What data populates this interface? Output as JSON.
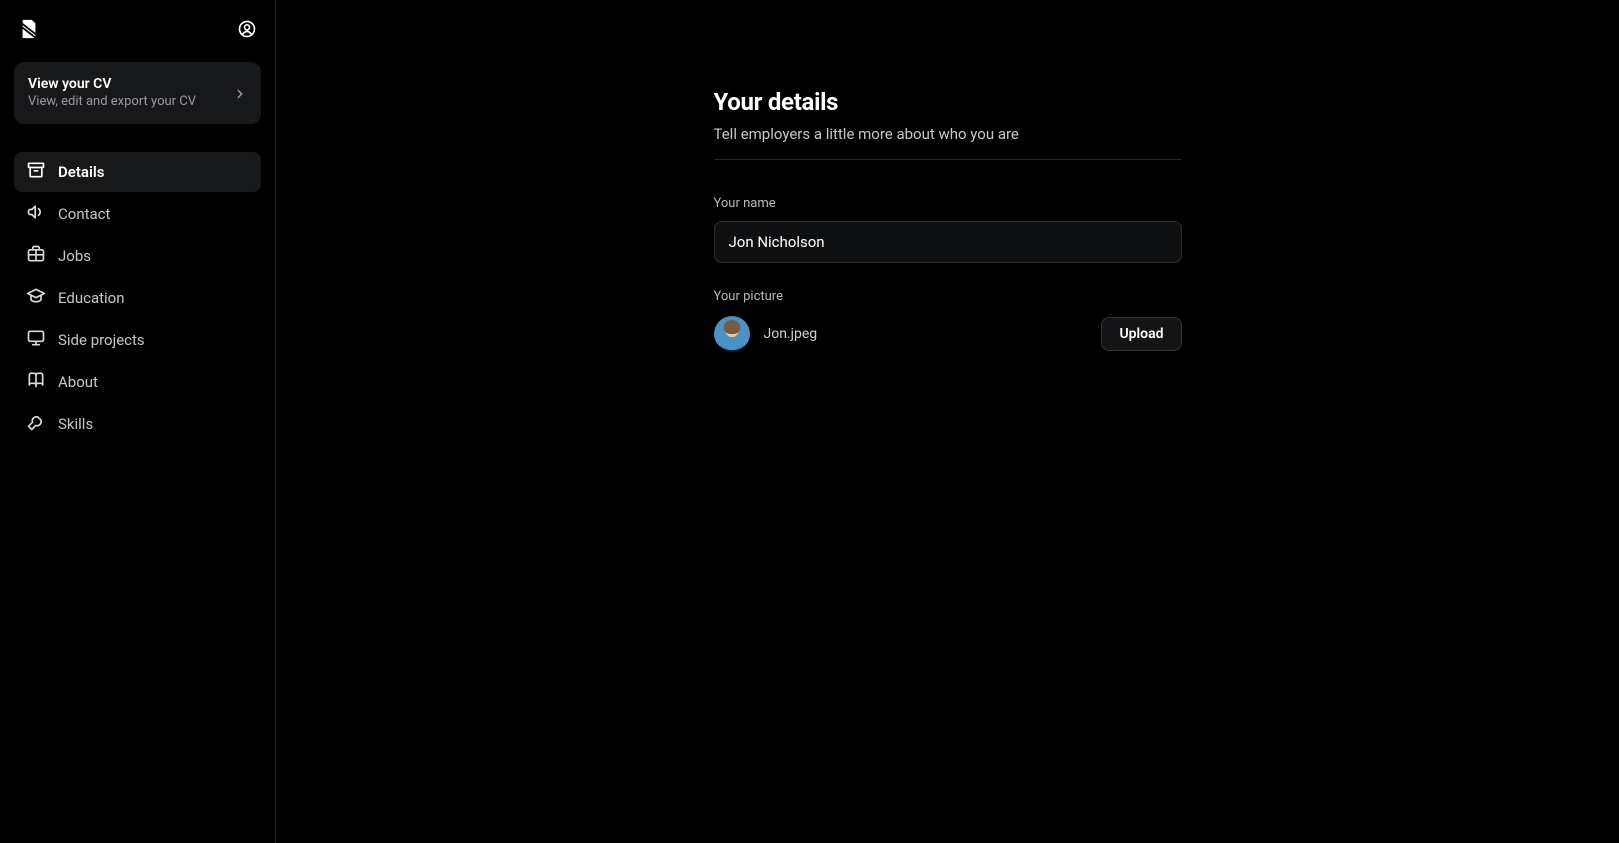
{
  "sidebar": {
    "view_cv": {
      "title": "View your CV",
      "subtitle": "View, edit and export your CV"
    },
    "nav": [
      {
        "id": "details",
        "label": "Details",
        "icon": "archive-icon",
        "active": true
      },
      {
        "id": "contact",
        "label": "Contact",
        "icon": "megaphone-icon",
        "active": false
      },
      {
        "id": "jobs",
        "label": "Jobs",
        "icon": "briefcase-icon",
        "active": false
      },
      {
        "id": "education",
        "label": "Education",
        "icon": "graduation-cap-icon",
        "active": false
      },
      {
        "id": "sideprojects",
        "label": "Side projects",
        "icon": "monitor-icon",
        "active": false
      },
      {
        "id": "about",
        "label": "About",
        "icon": "book-icon",
        "active": false
      },
      {
        "id": "skills",
        "label": "Skills",
        "icon": "wrench-icon",
        "active": false
      }
    ]
  },
  "main": {
    "title": "Your details",
    "subtitle": "Tell employers a little more about who you are",
    "name_label": "Your name",
    "name_value": "Jon Nicholson",
    "picture_label": "Your picture",
    "picture_filename": "Jon.jpeg",
    "upload_button": "Upload"
  }
}
